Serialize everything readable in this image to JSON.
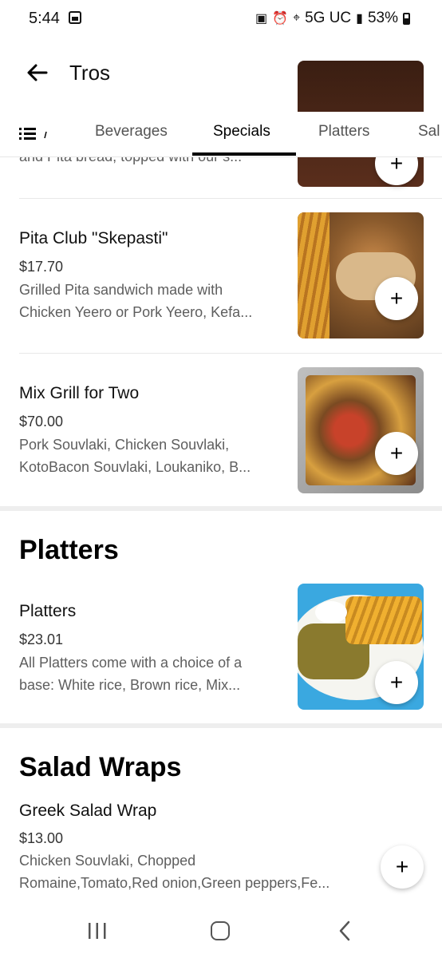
{
  "status_bar": {
    "time": "5:44",
    "network": "5G UC",
    "battery": "53%"
  },
  "header": {
    "title": "Tros"
  },
  "tabs": [
    {
      "label": "Beverages"
    },
    {
      "label": "Specials",
      "active": true
    },
    {
      "label": "Platters"
    },
    {
      "label": "Sal"
    }
  ],
  "items": {
    "partial": {
      "desc": "and Pita bread, topped with our s..."
    },
    "pita_club": {
      "name": "Pita Club \"Skepasti\"",
      "price": "$17.70",
      "desc_line1": "Grilled Pita sandwich made with",
      "desc_line2": "Chicken Yeero or Pork Yeero, Kefa..."
    },
    "mix_grill": {
      "name": "Mix Grill for Two",
      "price": "$70.00",
      "desc_line1": "Pork Souvlaki, Chicken Souvlaki,",
      "desc_line2": "KotoBacon Souvlaki, Loukaniko, B..."
    },
    "platters": {
      "name": "Platters",
      "price": "$23.01",
      "desc_line1": "All Platters come with a choice of a",
      "desc_line2": "base:  White rice, Brown rice, Mix..."
    },
    "greek_salad_wrap": {
      "name": "Greek Salad Wrap",
      "price": "$13.00",
      "desc_line1": "Chicken Souvlaki, Chopped",
      "desc_line2": "Romaine,Tomato,Red onion,Green peppers,Fe..."
    }
  },
  "sections": {
    "platters": "Platters",
    "salad_wraps": "Salad Wraps"
  },
  "add_label": "+",
  "colors": {
    "accent": "#000000",
    "secondary_text": "#5e5e5e",
    "platter_bg": "#3aa8e0"
  }
}
